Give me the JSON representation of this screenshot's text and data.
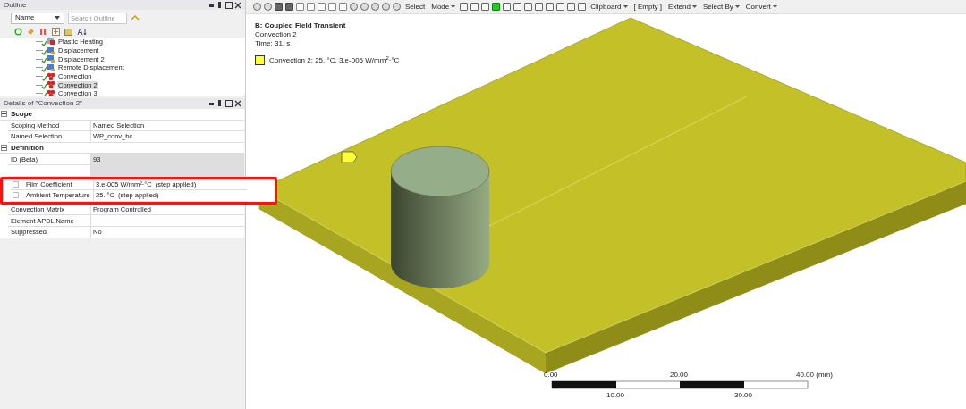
{
  "outline": {
    "title": "Outline",
    "sort_field": "Name",
    "search_placeholder": "Search Outline",
    "tree": [
      {
        "label": "Plastic Heating",
        "kind": "heating",
        "selected": false
      },
      {
        "label": "Displacement",
        "kind": "displacement",
        "selected": false
      },
      {
        "label": "Displacement 2",
        "kind": "displacement",
        "selected": false
      },
      {
        "label": "Remote Displacement",
        "kind": "displacement",
        "selected": false
      },
      {
        "label": "Convection",
        "kind": "convection",
        "selected": false
      },
      {
        "label": "Convection 2",
        "kind": "convection",
        "selected": true
      },
      {
        "label": "Convection 3",
        "kind": "convection",
        "selected": false
      }
    ]
  },
  "details": {
    "title": "Details of \"Convection 2\"",
    "sections": [
      {
        "title": "Scope",
        "expanded": true,
        "rows": [
          {
            "name": "Scoping Method",
            "value": "Named Selection",
            "readonly": false
          },
          {
            "name": "Named Selection",
            "value": "WP_conv_bc",
            "readonly": false
          }
        ]
      },
      {
        "title": "Definition",
        "expanded": true,
        "rows": [
          {
            "name": "ID (Beta)",
            "value": "93",
            "readonly": true
          },
          {
            "name": "",
            "value": "",
            "readonly": true
          },
          {
            "name": "Film Coefficient",
            "value": "3.e-005 W/mm²·°C  (step applied)",
            "readonly": false,
            "kind": "checkbox",
            "checked": false,
            "marked": true
          },
          {
            "name": "Ambient Temperature",
            "value": "25. °C  (step applied)",
            "readonly": false,
            "kind": "checkbox",
            "checked": false,
            "marked": true
          },
          {
            "name": "Convection Matrix",
            "value": "Program Controlled",
            "readonly": false
          },
          {
            "name": "Element APDL Name",
            "value": "",
            "readonly": false
          },
          {
            "name": "Suppressed",
            "value": "No",
            "readonly": false
          }
        ]
      }
    ]
  },
  "toolbar": {
    "buttons": [
      {
        "label": "Select",
        "kind": "text"
      },
      {
        "label": "Mode",
        "kind": "dropdown"
      },
      {
        "label": "Clipboard",
        "kind": "dropdown"
      },
      {
        "label": "[ Empty ]",
        "kind": "text"
      },
      {
        "label": "Extend",
        "kind": "dropdown"
      },
      {
        "label": "Select By",
        "kind": "dropdown"
      },
      {
        "label": "Convert",
        "kind": "dropdown"
      }
    ]
  },
  "viewport": {
    "analysis": "B: Coupled Field Transient",
    "object": "Convection 2",
    "time": "Time: 31. s",
    "legend": [
      {
        "label": "Convection 2: 25. °C, 3.e-005 W/mm$^{2}$·°C",
        "color": "#ffff33"
      }
    ],
    "scale": {
      "top_labels": [
        "0.00",
        "20.00",
        "40.00 (mm)"
      ],
      "bottom_labels": [
        "10.00",
        "30.00"
      ]
    }
  }
}
